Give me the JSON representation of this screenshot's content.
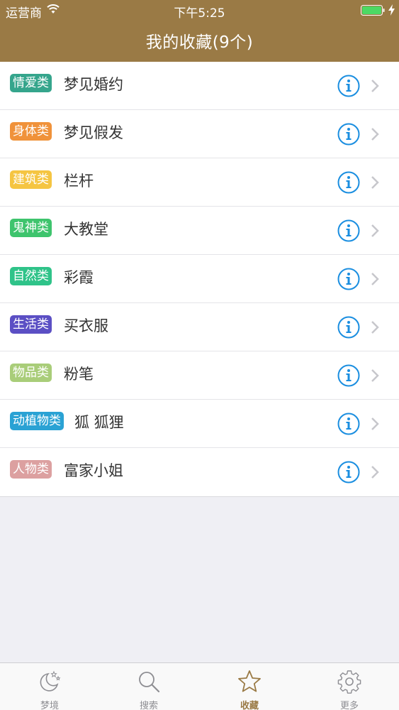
{
  "status_bar": {
    "carrier": "运营商",
    "time": "下午5:25",
    "battery_color": "#4cd964"
  },
  "header": {
    "title": "我的收藏(9个)",
    "background": "#9a7a45"
  },
  "favorites": [
    {
      "category": "情爱类",
      "title": "梦见婚约",
      "color": "#35a58c"
    },
    {
      "category": "身体类",
      "title": "梦见假发",
      "color": "#f0923a"
    },
    {
      "category": "建筑类",
      "title": "栏杆",
      "color": "#f5c542"
    },
    {
      "category": "鬼神类",
      "title": "大教堂",
      "color": "#3ec46d"
    },
    {
      "category": "自然类",
      "title": "彩霞",
      "color": "#2fc389"
    },
    {
      "category": "生活类",
      "title": "买衣服",
      "color": "#5b4fc4"
    },
    {
      "category": "物品类",
      "title": "粉笔",
      "color": "#a9cd79"
    },
    {
      "category": "动植物类",
      "title": "狐 狐狸",
      "color": "#2aa2d4"
    },
    {
      "category": "人物类",
      "title": "富家小姐",
      "color": "#dca0a0"
    }
  ],
  "tabbar": {
    "tabs": [
      {
        "label": "梦境",
        "icon": "moon-stars-icon"
      },
      {
        "label": "搜索",
        "icon": "search-icon"
      },
      {
        "label": "收藏",
        "icon": "star-icon",
        "active": true
      },
      {
        "label": "更多",
        "icon": "gear-icon"
      }
    ],
    "active_color": "#9a7a45",
    "inactive_color": "#8e8e93"
  },
  "accent_info_color": "#1a8ee0"
}
